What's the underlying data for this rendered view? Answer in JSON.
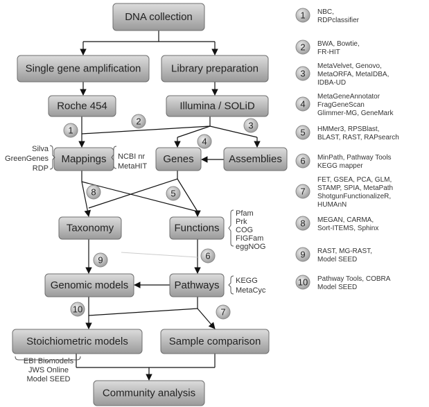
{
  "boxes": {
    "dna": "DNA collection",
    "single": "Single gene amplification",
    "library": "Library preparation",
    "roche": "Roche 454",
    "illumina": "Illumina / SOLiD",
    "mappings": "Mappings",
    "genes": "Genes",
    "assemblies": "Assemblies",
    "taxonomy": "Taxonomy",
    "functions": "Functions",
    "genomic": "Genomic models",
    "pathways": "Pathways",
    "stoich": "Stoichiometric models",
    "sample": "Sample comparison",
    "community": "Community analysis"
  },
  "side_labels": {
    "mappings_left": [
      "Silva",
      "GreenGenes",
      "RDP"
    ],
    "mappings_right": [
      "NCBI nr",
      "MetaHIT"
    ],
    "functions": [
      "Pfam",
      "Prk",
      "COG",
      "FIGFam",
      "eggNOG"
    ],
    "pathways": [
      "KEGG",
      "MetaCyc"
    ],
    "stoich": [
      "EBI Biomodels",
      "JWS Online",
      "Model SEED"
    ]
  },
  "step_numbers": [
    "1",
    "2",
    "3",
    "4",
    "5",
    "6",
    "7",
    "8",
    "9",
    "10"
  ],
  "legend": [
    {
      "num": "1",
      "lines": [
        "NBC,",
        "RDPclassifier"
      ]
    },
    {
      "num": "2",
      "lines": [
        "BWA, Bowtie,",
        "FR-HIT"
      ]
    },
    {
      "num": "3",
      "lines": [
        "MetaVelvet, Genovo,",
        "MetaORFA, MetaIDBA,",
        "IDBA-UD"
      ]
    },
    {
      "num": "4",
      "lines": [
        "MetaGeneAnnotator",
        "FragGeneScan",
        "Glimmer-MG, GeneMark"
      ]
    },
    {
      "num": "5",
      "lines": [
        "HMMer3, RPSBlast,",
        "BLAST, RAST, RAPsearch"
      ]
    },
    {
      "num": "6",
      "lines": [
        "MinPath, Pathway Tools",
        "KEGG mapper"
      ]
    },
    {
      "num": "7",
      "lines": [
        "FET, GSEA,  PCA, GLM,",
        "STAMP, SPIA, MetaPath",
        "ShotgunFunctionalizeR,",
        "HUMAnN"
      ]
    },
    {
      "num": "8",
      "lines": [
        "MEGAN, CARMA,",
        "Sort-ITEMS, Sphinx"
      ]
    },
    {
      "num": "9",
      "lines": [
        "RAST, MG-RAST,",
        "Model SEED"
      ]
    },
    {
      "num": "10",
      "lines": [
        "Pathway Tools, COBRA",
        "Model SEED"
      ]
    }
  ]
}
